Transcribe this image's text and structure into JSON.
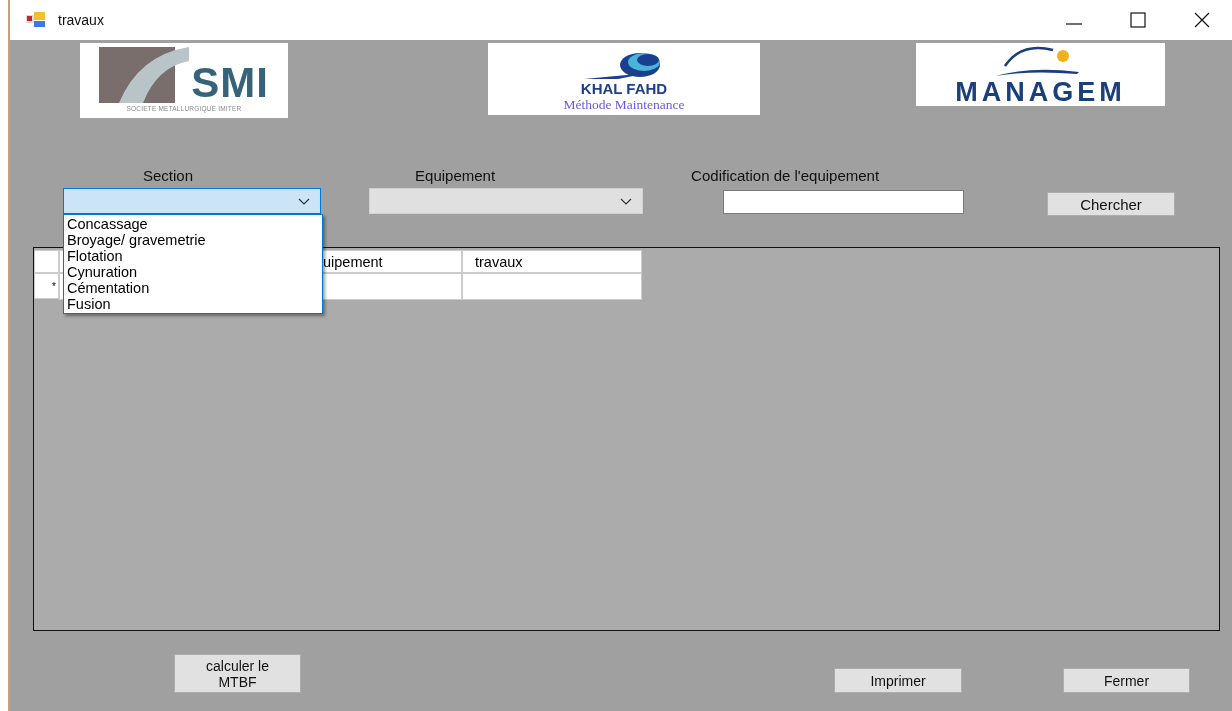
{
  "window": {
    "title": "travaux"
  },
  "logos": [
    {
      "kind": "smi",
      "name": "SMI",
      "tagline": "SOCIETE METALLURGIQUE IMITER"
    },
    {
      "kind": "khal",
      "name": "KHAL FAHD",
      "tagline": "Méthode Maintenance"
    },
    {
      "kind": "managem",
      "name": "MANAGEM"
    }
  ],
  "section": {
    "label": "Section",
    "expanded": true,
    "options": [
      {
        "label": "Concassage",
        "selected": false
      },
      {
        "label": "Broyage/ gravemetrie",
        "selected": false
      },
      {
        "label": "Flotation",
        "selected": false
      },
      {
        "label": "Cynuration",
        "selected": false
      },
      {
        "label": "Cémentation",
        "selected": false
      },
      {
        "label": "Fusion",
        "selected": false
      }
    ]
  },
  "equipement": {
    "label": "Equipement",
    "disabled": true
  },
  "codification": {
    "label": "Codification de l'equipement"
  },
  "search_button": "Chercher",
  "grid": {
    "columns": [
      "uipement",
      "travaux"
    ],
    "new_row_marker": "*"
  },
  "buttons": [
    "calculer le\nMTBF",
    "Imprimer",
    "Fermer"
  ]
}
